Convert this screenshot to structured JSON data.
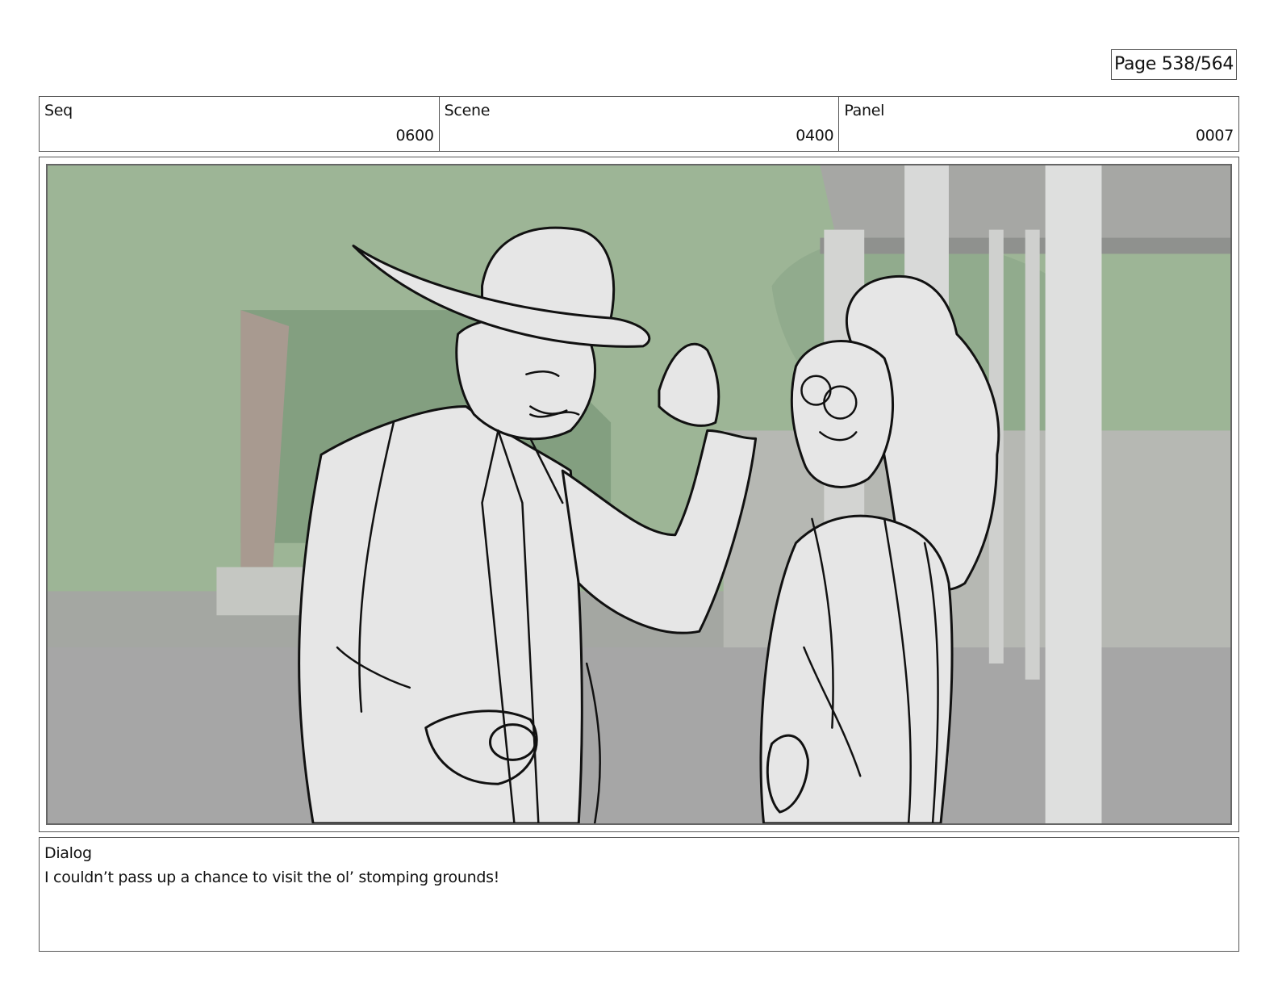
{
  "page": {
    "label": "Page 538/564"
  },
  "header": {
    "seq": {
      "label": "Seq",
      "value": "0600"
    },
    "scene": {
      "label": "Scene",
      "value": "0400"
    },
    "panel": {
      "label": "Panel",
      "value": "0007"
    }
  },
  "panel_image": {
    "description_icon": "storyboard-sketch",
    "colors": {
      "sky_green": "#9db596",
      "wall_gray": "#b4b6b2",
      "ground_gray": "#a6a6a6",
      "pillar_white": "#d8d9d8",
      "figure_fill": "#e6e6e6",
      "line_ink": "#111111"
    }
  },
  "dialog": {
    "label": "Dialog",
    "text": "I couldn’t pass up a chance to visit the ol’ stomping grounds!"
  }
}
